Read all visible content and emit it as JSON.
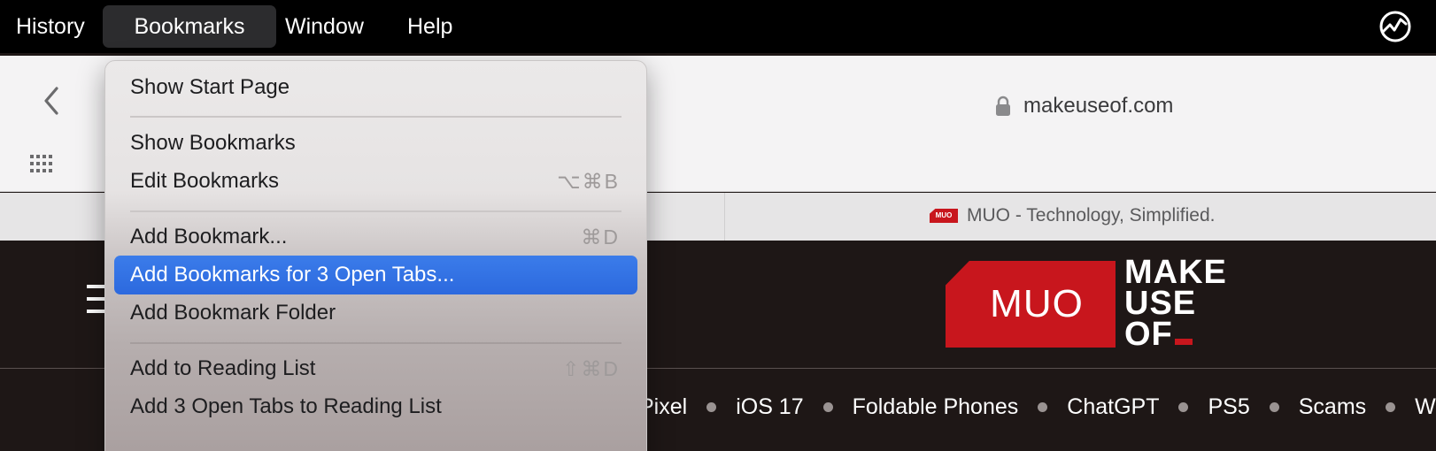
{
  "menubar": {
    "items": [
      "History",
      "Bookmarks",
      "Window",
      "Help"
    ],
    "active": "Bookmarks",
    "status_icon": "activity-monitor-icon"
  },
  "browser": {
    "address": "makeuseof.com",
    "tab_title": "MUO - Technology, Simplified.",
    "tab_favicon_text": "MUO"
  },
  "page": {
    "logo": {
      "badge": "MUO",
      "line1": "MAKE",
      "line2": "USE",
      "line3": "OF"
    },
    "topics": [
      "Pixel",
      "iOS 17",
      "Foldable Phones",
      "ChatGPT",
      "PS5",
      "Scams",
      "Wi"
    ]
  },
  "bookmarks_menu": {
    "items": [
      {
        "label": "Show Start Page",
        "shortcut": ""
      },
      {
        "label": "Show Bookmarks",
        "shortcut": ""
      },
      {
        "label": "Edit Bookmarks",
        "shortcut": "⌥⌘B"
      },
      {
        "label": "Add Bookmark...",
        "shortcut": "⌘D"
      },
      {
        "label": "Add Bookmarks for 3 Open Tabs...",
        "shortcut": ""
      },
      {
        "label": "Add Bookmark Folder",
        "shortcut": ""
      },
      {
        "label": "Add to Reading List",
        "shortcut": "⇧⌘D"
      },
      {
        "label": "Add 3 Open Tabs to Reading List",
        "shortcut": ""
      }
    ],
    "highlighted": "Add Bookmarks for 3 Open Tabs..."
  },
  "colors": {
    "accent": "#2c69de",
    "brand_red": "#c8161d",
    "menubar": "#000000"
  }
}
